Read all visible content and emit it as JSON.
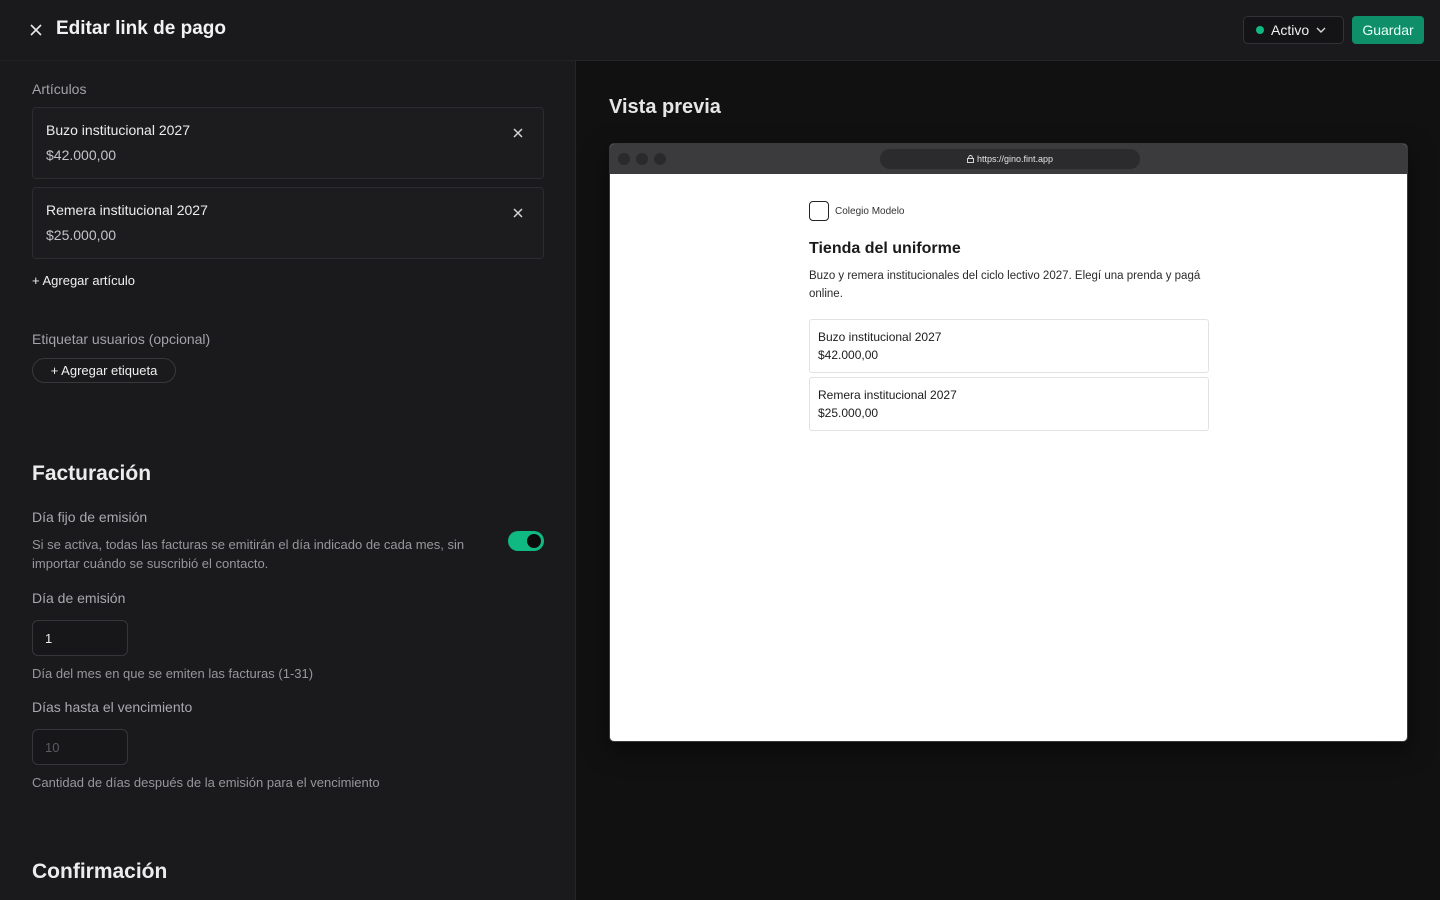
{
  "header": {
    "title": "Editar link de pago",
    "status": "Activo",
    "save_label": "Guardar"
  },
  "articles": {
    "label": "Artículos",
    "items": [
      {
        "name": "Buzo institucional 2027",
        "price": "$42.000,00"
      },
      {
        "name": "Remera institucional 2027",
        "price": "$25.000,00"
      }
    ],
    "add_label": "+ Agregar artículo"
  },
  "tags": {
    "label": "Etiquetar usuarios (opcional)",
    "add_label": "+ Agregar etiqueta"
  },
  "billing": {
    "heading": "Facturación",
    "fixed_day_label": "Día fijo de emisión",
    "fixed_day_help": "Si se activa, todas las facturas se emitirán el día indicado de cada mes, sin importar cuándo se suscribió el contacto.",
    "fixed_day_enabled": true,
    "issue_day_label": "Día de emisión",
    "issue_day_value": "1",
    "issue_day_help": "Día del mes en que se emiten las facturas (1-31)",
    "due_days_label": "Días hasta el vencimiento",
    "due_days_placeholder": "10",
    "due_days_help": "Cantidad de días después de la emisión para el vencimiento"
  },
  "confirmation": {
    "heading": "Confirmación"
  },
  "preview": {
    "title": "Vista previa",
    "url": "https://gino.fint.app",
    "org_name": "Colegio Modelo",
    "store_title": "Tienda del uniforme",
    "store_description": "Buzo y remera institucionales del ciclo lectivo 2027. Elegí una prenda y pagá online.",
    "products": [
      {
        "name": "Buzo institucional 2027",
        "price": "$42.000,00"
      },
      {
        "name": "Remera institucional 2027",
        "price": "$25.000,00"
      }
    ]
  },
  "colors": {
    "accent": "#10b981",
    "save_button": "#0e8f6a",
    "background": "#111112",
    "panel": "#1a1a1c"
  },
  "icons": {
    "close": "close-icon",
    "chevron": "chevron-down-icon",
    "remove": "remove-icon",
    "lock": "lock-icon"
  }
}
